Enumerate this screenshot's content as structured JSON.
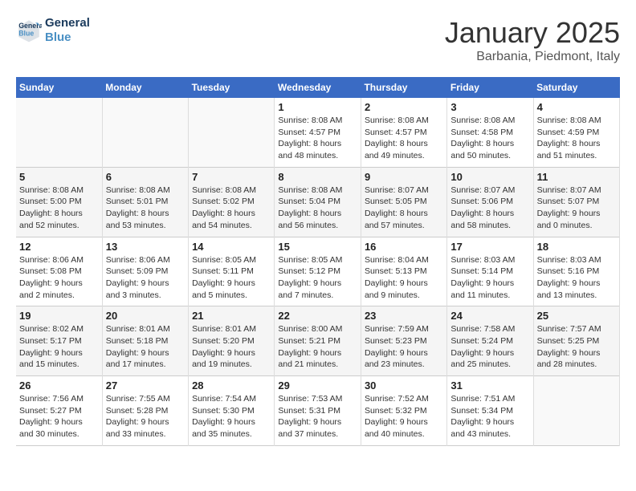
{
  "header": {
    "logo_line1": "General",
    "logo_line2": "Blue",
    "month": "January 2025",
    "location": "Barbania, Piedmont, Italy"
  },
  "days_of_week": [
    "Sunday",
    "Monday",
    "Tuesday",
    "Wednesday",
    "Thursday",
    "Friday",
    "Saturday"
  ],
  "weeks": [
    [
      {
        "day": "",
        "info": ""
      },
      {
        "day": "",
        "info": ""
      },
      {
        "day": "",
        "info": ""
      },
      {
        "day": "1",
        "info": "Sunrise: 8:08 AM\nSunset: 4:57 PM\nDaylight: 8 hours\nand 48 minutes."
      },
      {
        "day": "2",
        "info": "Sunrise: 8:08 AM\nSunset: 4:57 PM\nDaylight: 8 hours\nand 49 minutes."
      },
      {
        "day": "3",
        "info": "Sunrise: 8:08 AM\nSunset: 4:58 PM\nDaylight: 8 hours\nand 50 minutes."
      },
      {
        "day": "4",
        "info": "Sunrise: 8:08 AM\nSunset: 4:59 PM\nDaylight: 8 hours\nand 51 minutes."
      }
    ],
    [
      {
        "day": "5",
        "info": "Sunrise: 8:08 AM\nSunset: 5:00 PM\nDaylight: 8 hours\nand 52 minutes."
      },
      {
        "day": "6",
        "info": "Sunrise: 8:08 AM\nSunset: 5:01 PM\nDaylight: 8 hours\nand 53 minutes."
      },
      {
        "day": "7",
        "info": "Sunrise: 8:08 AM\nSunset: 5:02 PM\nDaylight: 8 hours\nand 54 minutes."
      },
      {
        "day": "8",
        "info": "Sunrise: 8:08 AM\nSunset: 5:04 PM\nDaylight: 8 hours\nand 56 minutes."
      },
      {
        "day": "9",
        "info": "Sunrise: 8:07 AM\nSunset: 5:05 PM\nDaylight: 8 hours\nand 57 minutes."
      },
      {
        "day": "10",
        "info": "Sunrise: 8:07 AM\nSunset: 5:06 PM\nDaylight: 8 hours\nand 58 minutes."
      },
      {
        "day": "11",
        "info": "Sunrise: 8:07 AM\nSunset: 5:07 PM\nDaylight: 9 hours\nand 0 minutes."
      }
    ],
    [
      {
        "day": "12",
        "info": "Sunrise: 8:06 AM\nSunset: 5:08 PM\nDaylight: 9 hours\nand 2 minutes."
      },
      {
        "day": "13",
        "info": "Sunrise: 8:06 AM\nSunset: 5:09 PM\nDaylight: 9 hours\nand 3 minutes."
      },
      {
        "day": "14",
        "info": "Sunrise: 8:05 AM\nSunset: 5:11 PM\nDaylight: 9 hours\nand 5 minutes."
      },
      {
        "day": "15",
        "info": "Sunrise: 8:05 AM\nSunset: 5:12 PM\nDaylight: 9 hours\nand 7 minutes."
      },
      {
        "day": "16",
        "info": "Sunrise: 8:04 AM\nSunset: 5:13 PM\nDaylight: 9 hours\nand 9 minutes."
      },
      {
        "day": "17",
        "info": "Sunrise: 8:03 AM\nSunset: 5:14 PM\nDaylight: 9 hours\nand 11 minutes."
      },
      {
        "day": "18",
        "info": "Sunrise: 8:03 AM\nSunset: 5:16 PM\nDaylight: 9 hours\nand 13 minutes."
      }
    ],
    [
      {
        "day": "19",
        "info": "Sunrise: 8:02 AM\nSunset: 5:17 PM\nDaylight: 9 hours\nand 15 minutes."
      },
      {
        "day": "20",
        "info": "Sunrise: 8:01 AM\nSunset: 5:18 PM\nDaylight: 9 hours\nand 17 minutes."
      },
      {
        "day": "21",
        "info": "Sunrise: 8:01 AM\nSunset: 5:20 PM\nDaylight: 9 hours\nand 19 minutes."
      },
      {
        "day": "22",
        "info": "Sunrise: 8:00 AM\nSunset: 5:21 PM\nDaylight: 9 hours\nand 21 minutes."
      },
      {
        "day": "23",
        "info": "Sunrise: 7:59 AM\nSunset: 5:23 PM\nDaylight: 9 hours\nand 23 minutes."
      },
      {
        "day": "24",
        "info": "Sunrise: 7:58 AM\nSunset: 5:24 PM\nDaylight: 9 hours\nand 25 minutes."
      },
      {
        "day": "25",
        "info": "Sunrise: 7:57 AM\nSunset: 5:25 PM\nDaylight: 9 hours\nand 28 minutes."
      }
    ],
    [
      {
        "day": "26",
        "info": "Sunrise: 7:56 AM\nSunset: 5:27 PM\nDaylight: 9 hours\nand 30 minutes."
      },
      {
        "day": "27",
        "info": "Sunrise: 7:55 AM\nSunset: 5:28 PM\nDaylight: 9 hours\nand 33 minutes."
      },
      {
        "day": "28",
        "info": "Sunrise: 7:54 AM\nSunset: 5:30 PM\nDaylight: 9 hours\nand 35 minutes."
      },
      {
        "day": "29",
        "info": "Sunrise: 7:53 AM\nSunset: 5:31 PM\nDaylight: 9 hours\nand 37 minutes."
      },
      {
        "day": "30",
        "info": "Sunrise: 7:52 AM\nSunset: 5:32 PM\nDaylight: 9 hours\nand 40 minutes."
      },
      {
        "day": "31",
        "info": "Sunrise: 7:51 AM\nSunset: 5:34 PM\nDaylight: 9 hours\nand 43 minutes."
      },
      {
        "day": "",
        "info": ""
      }
    ]
  ]
}
